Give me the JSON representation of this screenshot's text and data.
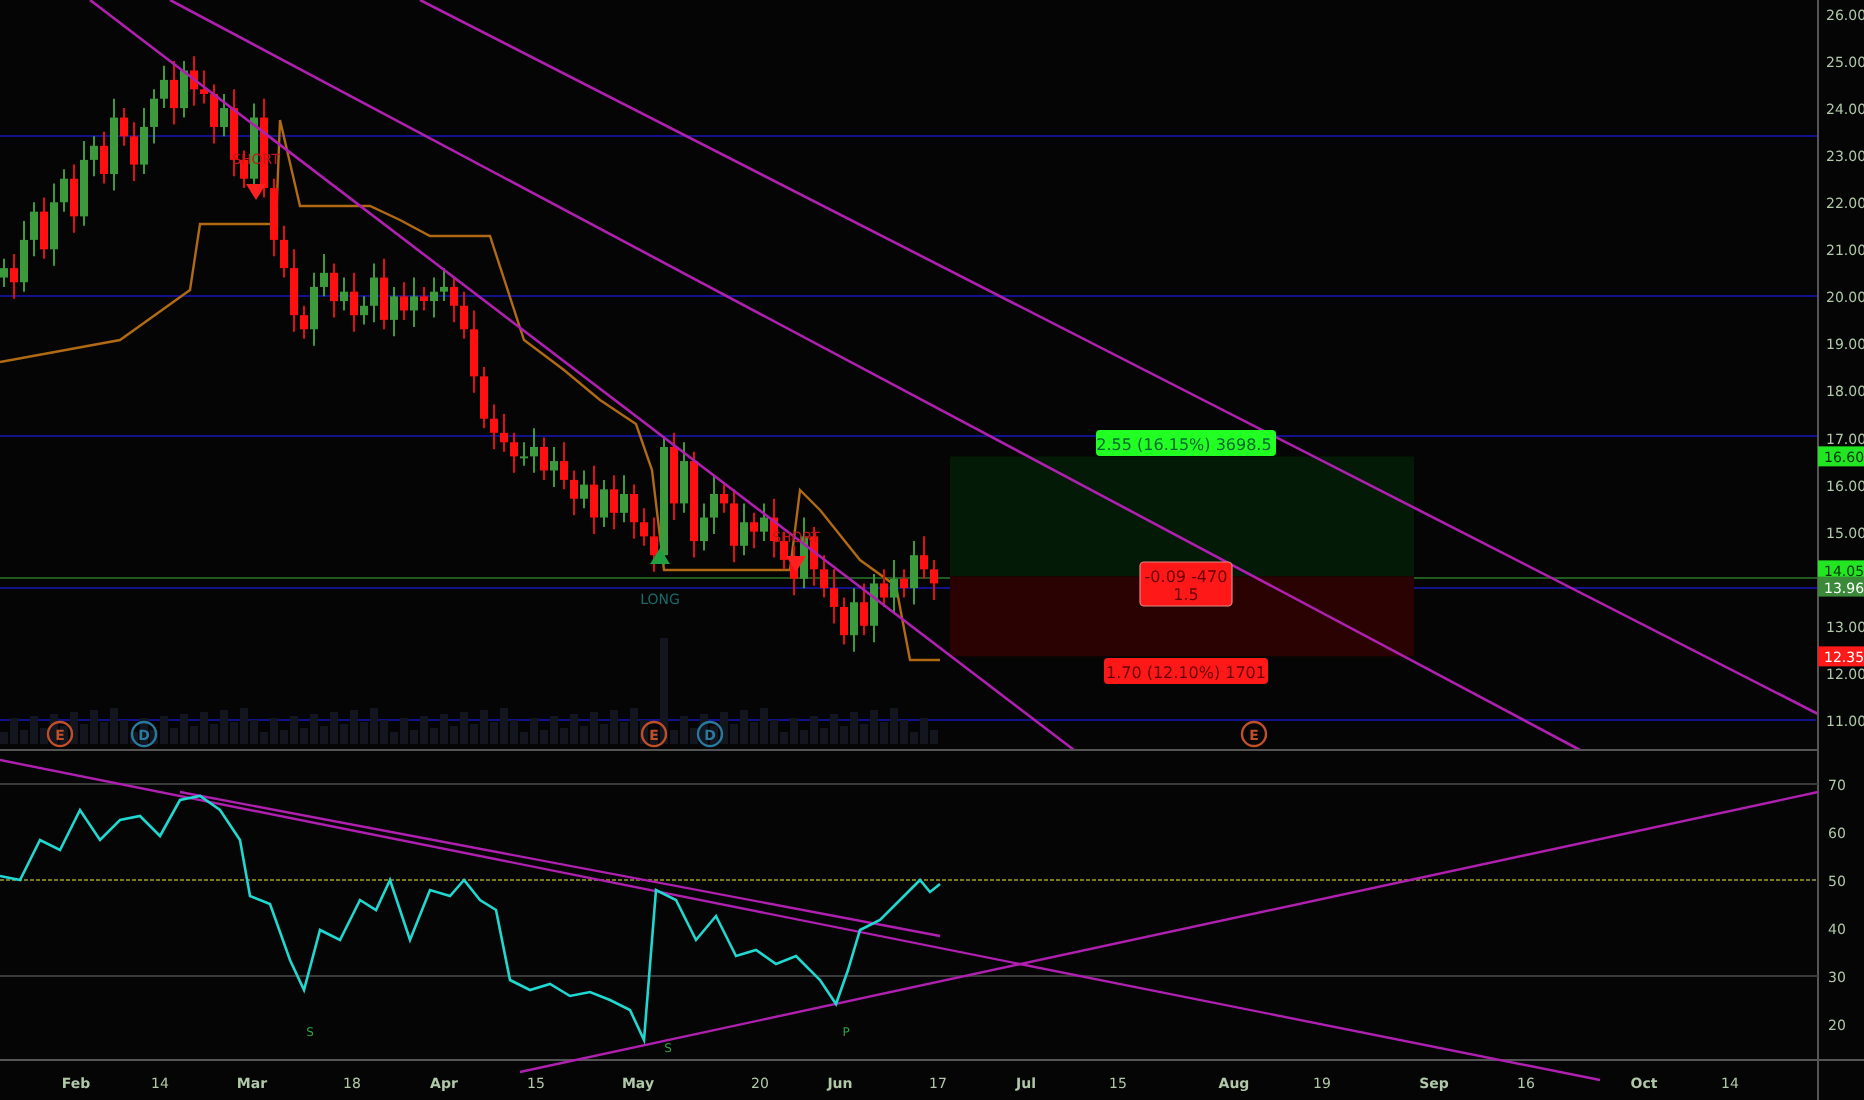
{
  "price_chart": {
    "price_axis": [
      "26.00",
      "25.00",
      "24.00",
      "23.00",
      "22.00",
      "21.00",
      "20.00",
      "19.00",
      "18.00",
      "17.00",
      "16.00",
      "15.00",
      "13.00",
      "12.00",
      "11.00"
    ],
    "price_tags": [
      {
        "text": "16.60",
        "kind": "target"
      },
      {
        "text": "14.05",
        "kind": "entry"
      },
      {
        "text": "13.96",
        "kind": "last"
      },
      {
        "text": "12.35",
        "kind": "stop"
      }
    ],
    "position": {
      "target_label": "2.55 (16.15%) 3698.5",
      "entry_label": [
        "-0.09 -470",
        "1.5"
      ],
      "stop_label": "1.70 (12.10%) 1701"
    },
    "signals": [
      {
        "text": "SHORT",
        "kind": "short"
      },
      {
        "text": "LONG",
        "kind": "long"
      },
      {
        "text": "SHORT",
        "kind": "short"
      }
    ],
    "events": [
      {
        "letter": "E",
        "color": "#c0502a"
      },
      {
        "letter": "D",
        "color": "#2a7aa0"
      },
      {
        "letter": "E",
        "color": "#c0502a"
      },
      {
        "letter": "D",
        "color": "#2a7aa0"
      },
      {
        "letter": "E",
        "color": "#c0502a"
      }
    ]
  },
  "rsi_pane": {
    "axis": [
      "70",
      "60",
      "50",
      "40",
      "30",
      "20"
    ],
    "pivots": [
      "S",
      "S",
      "P"
    ]
  },
  "time_axis": [
    "Feb",
    "14",
    "Mar",
    "18",
    "Apr",
    "15",
    "May",
    "20",
    "Jun",
    "17",
    "Jul",
    "15",
    "Aug",
    "19",
    "Sep",
    "16",
    "Oct",
    "14"
  ]
}
